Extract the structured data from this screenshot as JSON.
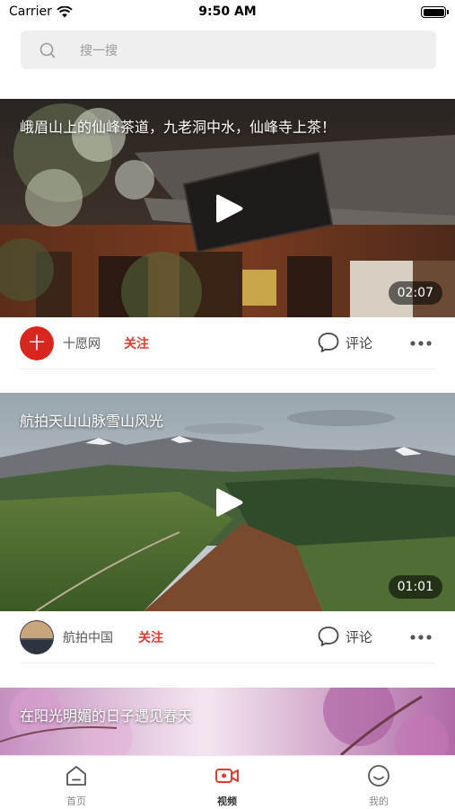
{
  "status_bar": {
    "carrier": "Carrier",
    "time": "9:50 AM"
  },
  "search": {
    "placeholder": "搜一搜"
  },
  "feed": [
    {
      "title": "峨眉山上的仙峰茶道，九老洞中水，仙峰寺上茶！",
      "duration": "02:07",
      "author": "十愿网",
      "follow_label": "关注",
      "comment_label": "评论",
      "avatar_text": "十"
    },
    {
      "title": "航拍天山山脉雪山风光",
      "duration": "01:01",
      "author": "航拍中国",
      "follow_label": "关注",
      "comment_label": "评论"
    },
    {
      "title": "在阳光明媚的日子遇见春天"
    }
  ],
  "tab_bar": {
    "tabs": [
      {
        "label": "首页",
        "icon": "home-icon",
        "active": false
      },
      {
        "label": "视频",
        "icon": "video-camera-icon",
        "active": true
      },
      {
        "label": "我的",
        "icon": "smiley-icon",
        "active": false
      }
    ]
  },
  "colors": {
    "accent": "#e23a2e",
    "search_bg": "#efefef",
    "divider": "#ececec"
  }
}
